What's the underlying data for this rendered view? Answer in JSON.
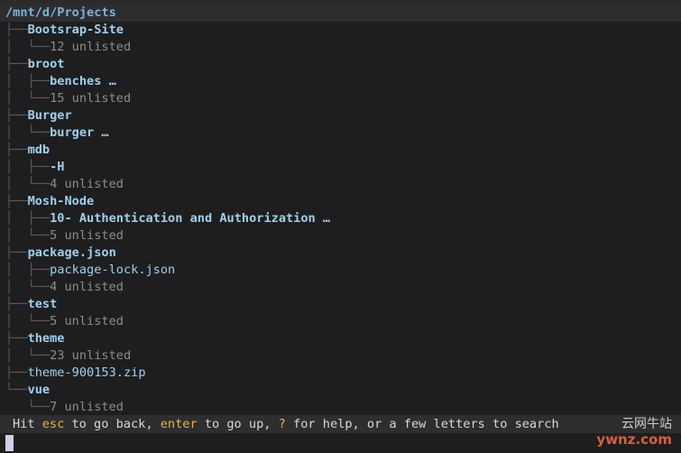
{
  "header": {
    "path": "/mnt/d/Projects"
  },
  "tree": [
    {
      "guide": "├──",
      "label": "Bootsrap-Site",
      "kind": "dir"
    },
    {
      "guide": "│  └──",
      "label": "12 unlisted",
      "kind": "unlisted"
    },
    {
      "guide": "├──",
      "label": "broot",
      "kind": "dir"
    },
    {
      "guide": "│  ├──",
      "label": "benches …",
      "kind": "dir"
    },
    {
      "guide": "│  └──",
      "label": "15 unlisted",
      "kind": "unlisted"
    },
    {
      "guide": "├──",
      "label": "Burger",
      "kind": "dir"
    },
    {
      "guide": "│  └──",
      "label": "burger …",
      "kind": "dir"
    },
    {
      "guide": "├──",
      "label": "mdb",
      "kind": "dir"
    },
    {
      "guide": "│  ├──",
      "label": "-H",
      "kind": "dir"
    },
    {
      "guide": "│  └──",
      "label": "4 unlisted",
      "kind": "unlisted"
    },
    {
      "guide": "├──",
      "label": "Mosh-Node",
      "kind": "dir"
    },
    {
      "guide": "│  ├──",
      "label": "10- Authentication and Authorization …",
      "kind": "dir"
    },
    {
      "guide": "│  └──",
      "label": "5 unlisted",
      "kind": "unlisted"
    },
    {
      "guide": "├──",
      "label": "package.json",
      "kind": "dir"
    },
    {
      "guide": "│  ├──",
      "label": "package-lock.json",
      "kind": "file"
    },
    {
      "guide": "│  └──",
      "label": "4 unlisted",
      "kind": "unlisted"
    },
    {
      "guide": "├──",
      "label": "test",
      "kind": "dir"
    },
    {
      "guide": "│  └──",
      "label": "5 unlisted",
      "kind": "unlisted"
    },
    {
      "guide": "├──",
      "label": "theme",
      "kind": "dir"
    },
    {
      "guide": "│  └──",
      "label": "23 unlisted",
      "kind": "unlisted"
    },
    {
      "guide": "├──",
      "label": "theme-900153.zip",
      "kind": "file"
    },
    {
      "guide": "└──",
      "label": "vue",
      "kind": "dir"
    },
    {
      "guide": "   └──",
      "label": "7 unlisted",
      "kind": "unlisted"
    }
  ],
  "status": {
    "t1": "Hit ",
    "k1": "esc",
    "t2": " to go back, ",
    "k2": "enter",
    "t3": " to go up, ",
    "k3": "?",
    "t4": " for help, or a few letters to search"
  },
  "watermark": {
    "line1": "云网牛站",
    "line2": "ywnz.com"
  },
  "colors": {
    "background": "#1e1e1e",
    "bar": "#2e2e31",
    "directory": "#9dd0ee",
    "unlisted": "#8c8c8c",
    "key_highlight": "#e8b33b"
  }
}
